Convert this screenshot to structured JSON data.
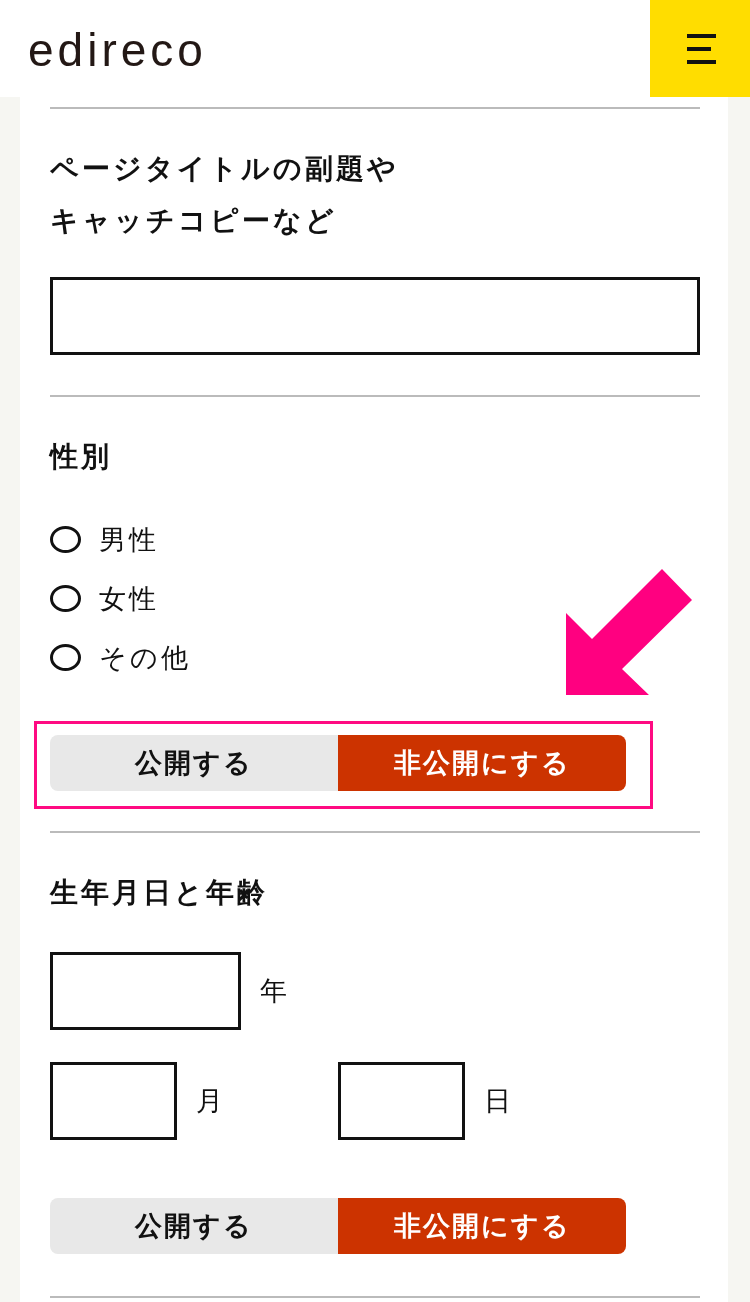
{
  "header": {
    "logo": "edireco"
  },
  "sections": [
    {
      "kind": "text",
      "title": "ページタイトルの副題やキャッチコピーなど"
    },
    {
      "kind": "radio",
      "title": "性別",
      "options": [
        {
          "label": "男性",
          "checked": false
        },
        {
          "label": "女性",
          "checked": false
        },
        {
          "label": "その他",
          "checked": false
        }
      ],
      "visibility": {
        "highlighted": true,
        "options": [
          {
            "label": "公開する",
            "selected": false
          },
          {
            "label": "非公開にする",
            "selected": true
          }
        ]
      }
    },
    {
      "kind": "date",
      "title": "生年月日と年齢",
      "fields": [
        {
          "kind": "year",
          "unit": "年"
        },
        {
          "kind": "month",
          "unit": "月"
        },
        {
          "kind": "day",
          "unit": "日"
        }
      ],
      "visibility": {
        "options": [
          {
            "label": "公開する",
            "selected": false
          },
          {
            "label": "非公開にする",
            "selected": true
          }
        ]
      }
    }
  ]
}
